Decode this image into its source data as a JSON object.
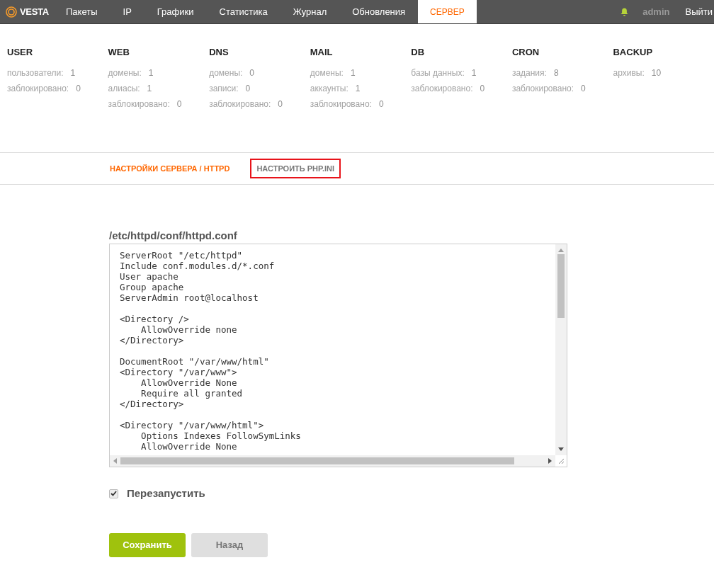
{
  "header": {
    "logo": "VESTA",
    "tabs": [
      {
        "label": "Пакеты",
        "selected": false
      },
      {
        "label": "IP",
        "selected": false
      },
      {
        "label": "Графики",
        "selected": false
      },
      {
        "label": "Статистика",
        "selected": false
      },
      {
        "label": "Журнал",
        "selected": false
      },
      {
        "label": "Обновления",
        "selected": false
      },
      {
        "label": "СЕРВЕР",
        "selected": true
      }
    ],
    "user": "admin",
    "logout": "Выйти"
  },
  "stats": [
    {
      "title": "USER",
      "rows": [
        {
          "label": "пользователи:",
          "value": "1"
        },
        {
          "label": "заблокировано:",
          "value": "0"
        }
      ]
    },
    {
      "title": "WEB",
      "rows": [
        {
          "label": "домены:",
          "value": "1"
        },
        {
          "label": "алиасы:",
          "value": "1"
        },
        {
          "label": "заблокировано:",
          "value": "0"
        }
      ]
    },
    {
      "title": "DNS",
      "rows": [
        {
          "label": "домены:",
          "value": "0"
        },
        {
          "label": "записи:",
          "value": "0"
        },
        {
          "label": "заблокировано:",
          "value": "0"
        }
      ]
    },
    {
      "title": "MAIL",
      "rows": [
        {
          "label": "домены:",
          "value": "1"
        },
        {
          "label": "аккаунты:",
          "value": "1"
        },
        {
          "label": "заблокировано:",
          "value": "0"
        }
      ]
    },
    {
      "title": "DB",
      "rows": [
        {
          "label": "базы данных:",
          "value": "1"
        },
        {
          "label": "заблокировано:",
          "value": "0"
        }
      ]
    },
    {
      "title": "CRON",
      "rows": [
        {
          "label": "задания:",
          "value": "8"
        },
        {
          "label": "заблокировано:",
          "value": "0"
        }
      ]
    },
    {
      "title": "BACKUP",
      "rows": [
        {
          "label": "архивы:",
          "value": "10"
        }
      ]
    }
  ],
  "subnav": [
    {
      "label": "НАСТРОЙКИ СЕРВЕРА / HTTPD",
      "selected": true,
      "highlighted": false
    },
    {
      "label": "НАСТРОИТЬ PHP.INI",
      "selected": false,
      "highlighted": true
    }
  ],
  "editor": {
    "path": "/etc/httpd/conf/httpd.conf",
    "blocks": [
      [
        "ServerRoot \"/etc/httpd\"",
        "Include conf.modules.d/*.conf",
        "User apache",
        "Group apache",
        "ServerAdmin root@localhost"
      ],
      [
        "<Directory />",
        "    AllowOverride none",
        "</Directory>"
      ],
      [
        "DocumentRoot \"/var/www/html\"",
        "<Directory \"/var/www\">",
        "    AllowOverride None",
        "    Require all granted",
        "</Directory>"
      ],
      [
        "<Directory \"/var/www/html\">",
        "    Options Indexes FollowSymLinks",
        "    AllowOverride None"
      ]
    ]
  },
  "restart": {
    "label": "Перезапустить",
    "checked": true
  },
  "buttons": [
    {
      "label": "Сохранить",
      "kind": "primary"
    },
    {
      "label": "Назад",
      "kind": "secondary"
    }
  ]
}
